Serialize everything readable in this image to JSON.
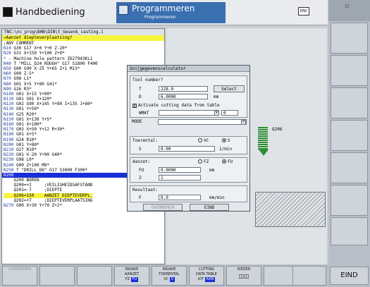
{
  "titlebar": {
    "mode_left": "Handbediening",
    "mode_right_title": "Programmeren",
    "mode_right_sub": "Programmeren",
    "dnc_label": "DNC"
  },
  "program": {
    "path": "TNC:\\nc_prog\\BHB\\DIN\\t_Gesenk_casting.i",
    "header": "→Aanzet diepteverplaatsing?",
    "lines": [
      {
        "n": "",
        "text": ";ANY COMMENT"
      },
      {
        "n": "N10",
        "text": " G30 G17 X+0 Y+0 Z-20*"
      },
      {
        "n": "N20",
        "text": " G31 X+150 Y+100 Z+0*"
      },
      {
        "n": "*",
        "text": " - Machine hole pattern ID27943KL1"
      },
      {
        "n": "N40",
        "text": " T \"MILL_D24_ROUGH\" G17 S1800 F400"
      },
      {
        "n": "N50",
        "text": " G00 G90 X-25 Y+65 Z+1 M13*"
      },
      {
        "n": "N60",
        "text": " G00 Z-5*"
      },
      {
        "n": "N70",
        "text": " G98 L1*"
      },
      {
        "n": "N80",
        "text": " G01 X+5 Y+80 G41*"
      },
      {
        "n": "N90",
        "text": " G26 R3*"
      },
      {
        "n": "N100",
        "text": " G01 X+15 Y+90*"
      },
      {
        "n": "N110",
        "text": " G01 G91 X+120*"
      },
      {
        "n": "N120",
        "text": " G02 G90 X+145 Y+80 I+135 J+80*"
      },
      {
        "n": "N130",
        "text": " G01 Y+50*"
      },
      {
        "n": "N140",
        "text": " G25 R20*"
      },
      {
        "n": "N150",
        "text": " G01 X+130 Y+5*"
      },
      {
        "n": "N160",
        "text": " G01 X+100*"
      },
      {
        "n": "N170",
        "text": " G03 X+50 Y+12 R+30*"
      },
      {
        "n": "N180",
        "text": " G01 X+5*"
      },
      {
        "n": "N190",
        "text": " G24 R10*"
      },
      {
        "n": "N200",
        "text": " G01 Y+80*"
      },
      {
        "n": "N210",
        "text": " G27 R10*"
      },
      {
        "n": "N220",
        "text": " G01 X-20 Y+90 G40*"
      },
      {
        "n": "N230",
        "text": " G98 L0*"
      },
      {
        "n": "N240",
        "text": " G00 Z+100 M9*"
      },
      {
        "n": "N250",
        "text": " T \"DRILL_D6\" G17 S3000 F300*"
      }
    ],
    "selected_line": "N260",
    "cycle_lines": [
      {
        "text": "    G200 BOREN",
        "hl": false
      },
      {
        "text": "    Q200=+2     ;VEILIGHEIDSAFSTAND",
        "hl": false
      },
      {
        "text": "    Q201=-7     ;DIEPTE",
        "hl": false
      },
      {
        "text": "    Q206=150    AANZET DIEPTEVERPL.",
        "hl": true
      },
      {
        "text": "    Q202=+7     ;DIEPTEVERPLAATSING",
        "hl": false
      }
    ],
    "last_line_n": "N270",
    "last_line_text": " G00 X+30 Y+70 Z+2*"
  },
  "graphic": {
    "label": "Q206"
  },
  "dialog": {
    "title": "Snijgegevenscalculator",
    "tool_group": "Tool number?",
    "t_label": "T",
    "t_value": "228.0",
    "select_label": "Select",
    "d_label": "D",
    "d_value": "6.0000",
    "d_unit": "mm",
    "activate_label": "Activate cutting data from table",
    "activate_checked": "X",
    "wmat_label": "WMAT",
    "wmat_value": "",
    "wmat_num": "0",
    "mode_label": "MODE",
    "mode_value": "",
    "speed_group": "Toerental:",
    "vc_label": "VC",
    "s_label": "S",
    "s_radio_label": "S",
    "s_value": "0.00",
    "s_unit": "1/min",
    "feed_group": "Aanzet:",
    "fz_label": "FZ",
    "fu_label": "FU",
    "fu_value": "0.0000",
    "fu_unit": "mm",
    "z_label": "Z",
    "z_value": "1",
    "result_group": "Resultaat:",
    "f_label": "F",
    "f_value": "0.0",
    "f_unit": "mm/min",
    "apply_label": "OVERNEMEN",
    "end_label": "EIND"
  },
  "softkeys": {
    "k1": "OVERNEMEN",
    "k4_l1": "INGAVE",
    "k4_l2": "AANZET",
    "k4_l3a": "FZ",
    "k4_l3b": "FU",
    "k5_l1": "INGAVE",
    "k5_l2": "TOERENTAL",
    "k5_l3a": "VC",
    "k5_l3b": "S",
    "k6_l1": "CUTTING",
    "k6_l2": "DATA TABLE",
    "k6_l3a": "UIT",
    "k6_l3b": "AAN",
    "k7": "KIEZEN",
    "end": "EIND"
  },
  "colors": {
    "selection": "#1b2fd6",
    "highlight": "#f7f43d",
    "mode_active": "#3a6fb0",
    "tool": "#2c8f34"
  }
}
